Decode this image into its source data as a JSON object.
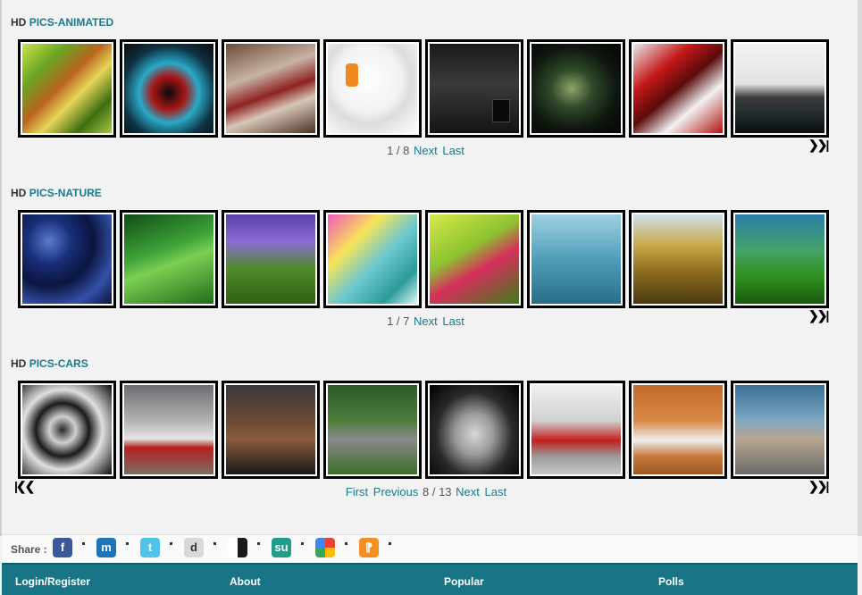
{
  "sections": [
    {
      "prefix": "HD",
      "category": "PICS-ANIMATED",
      "pager": {
        "first": "",
        "previous": "",
        "status": "1 / 8",
        "next": "Next",
        "last": "Last"
      },
      "thumbs": [
        {
          "alt": "Green and orange abstract swirl"
        },
        {
          "alt": "Blue red abstract spiral"
        },
        {
          "alt": "Red tubes abstract room"
        },
        {
          "alt": "3D man with phone"
        },
        {
          "alt": "Dark scene with die"
        },
        {
          "alt": "Green glowing abstract"
        },
        {
          "alt": "Red white abstract"
        },
        {
          "alt": "Dark landscape with wisps"
        }
      ]
    },
    {
      "prefix": "HD",
      "category": "PICS-NATURE",
      "pager": {
        "first": "",
        "previous": "",
        "status": "1 / 7",
        "next": "Next",
        "last": "Last"
      },
      "thumbs": [
        {
          "alt": "Blueberries"
        },
        {
          "alt": "Dew drop on leaf"
        },
        {
          "alt": "Purple flowers"
        },
        {
          "alt": "Water drop rainbow"
        },
        {
          "alt": "Bleeding heart flowers"
        },
        {
          "alt": "Dew drops on stem"
        },
        {
          "alt": "Dry grass"
        },
        {
          "alt": "Green grass closeup"
        }
      ]
    },
    {
      "prefix": "HD",
      "category": "PICS-CARS",
      "pager": {
        "first": "First",
        "previous": "Previous",
        "status": "8 / 13",
        "next": "Next",
        "last": "Last"
      },
      "thumbs": [
        {
          "alt": "Bentley wheel"
        },
        {
          "alt": "White red sports car"
        },
        {
          "alt": "Brown convertible"
        },
        {
          "alt": "Car on mountain road"
        },
        {
          "alt": "Silver concept car"
        },
        {
          "alt": "Red car in garage"
        },
        {
          "alt": "White SUV in desert"
        },
        {
          "alt": "White car on road"
        }
      ]
    }
  ],
  "share": {
    "label": "Share :",
    "icons": [
      "facebook-icon",
      "myspace-icon",
      "twitter-icon",
      "digg-icon",
      "delicious-icon",
      "stumbleupon-icon",
      "google-icon",
      "rss-icon"
    ]
  },
  "footer": {
    "login": "Login/Register",
    "about": "About",
    "popular": "Popular",
    "polls": "Polls"
  },
  "colors": {
    "link": "#1b7a8c",
    "footer": "#177585"
  }
}
